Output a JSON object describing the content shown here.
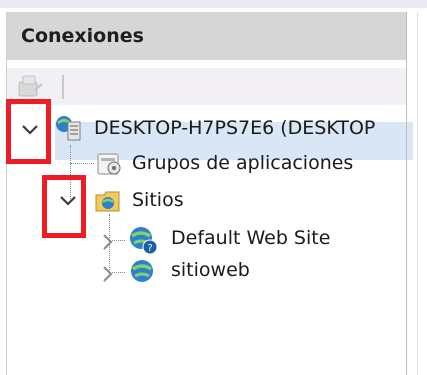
{
  "panel": {
    "title": "Conexiones"
  },
  "toolbar": {
    "icons": [
      "connect-icon"
    ]
  },
  "tree": {
    "server": {
      "label": "DESKTOP-H7PS7E6 (DESKTOP",
      "icon": "server-icon",
      "expanded": true,
      "selected": true
    },
    "app_pools": {
      "label": "Grupos de aplicaciones",
      "icon": "application-pools-icon"
    },
    "sites": {
      "label": "Sitios",
      "icon": "sites-folder-icon",
      "expanded": true,
      "children": [
        {
          "label": "Default Web Site",
          "icon": "website-globe-icon",
          "expanded": false
        },
        {
          "label": "sitioweb",
          "icon": "website-globe-icon",
          "expanded": false
        }
      ]
    }
  },
  "colors": {
    "header_bg": "#d6d6d6",
    "selection_bg": "#d8e6f5",
    "annotation_red": "#ee1c25"
  }
}
